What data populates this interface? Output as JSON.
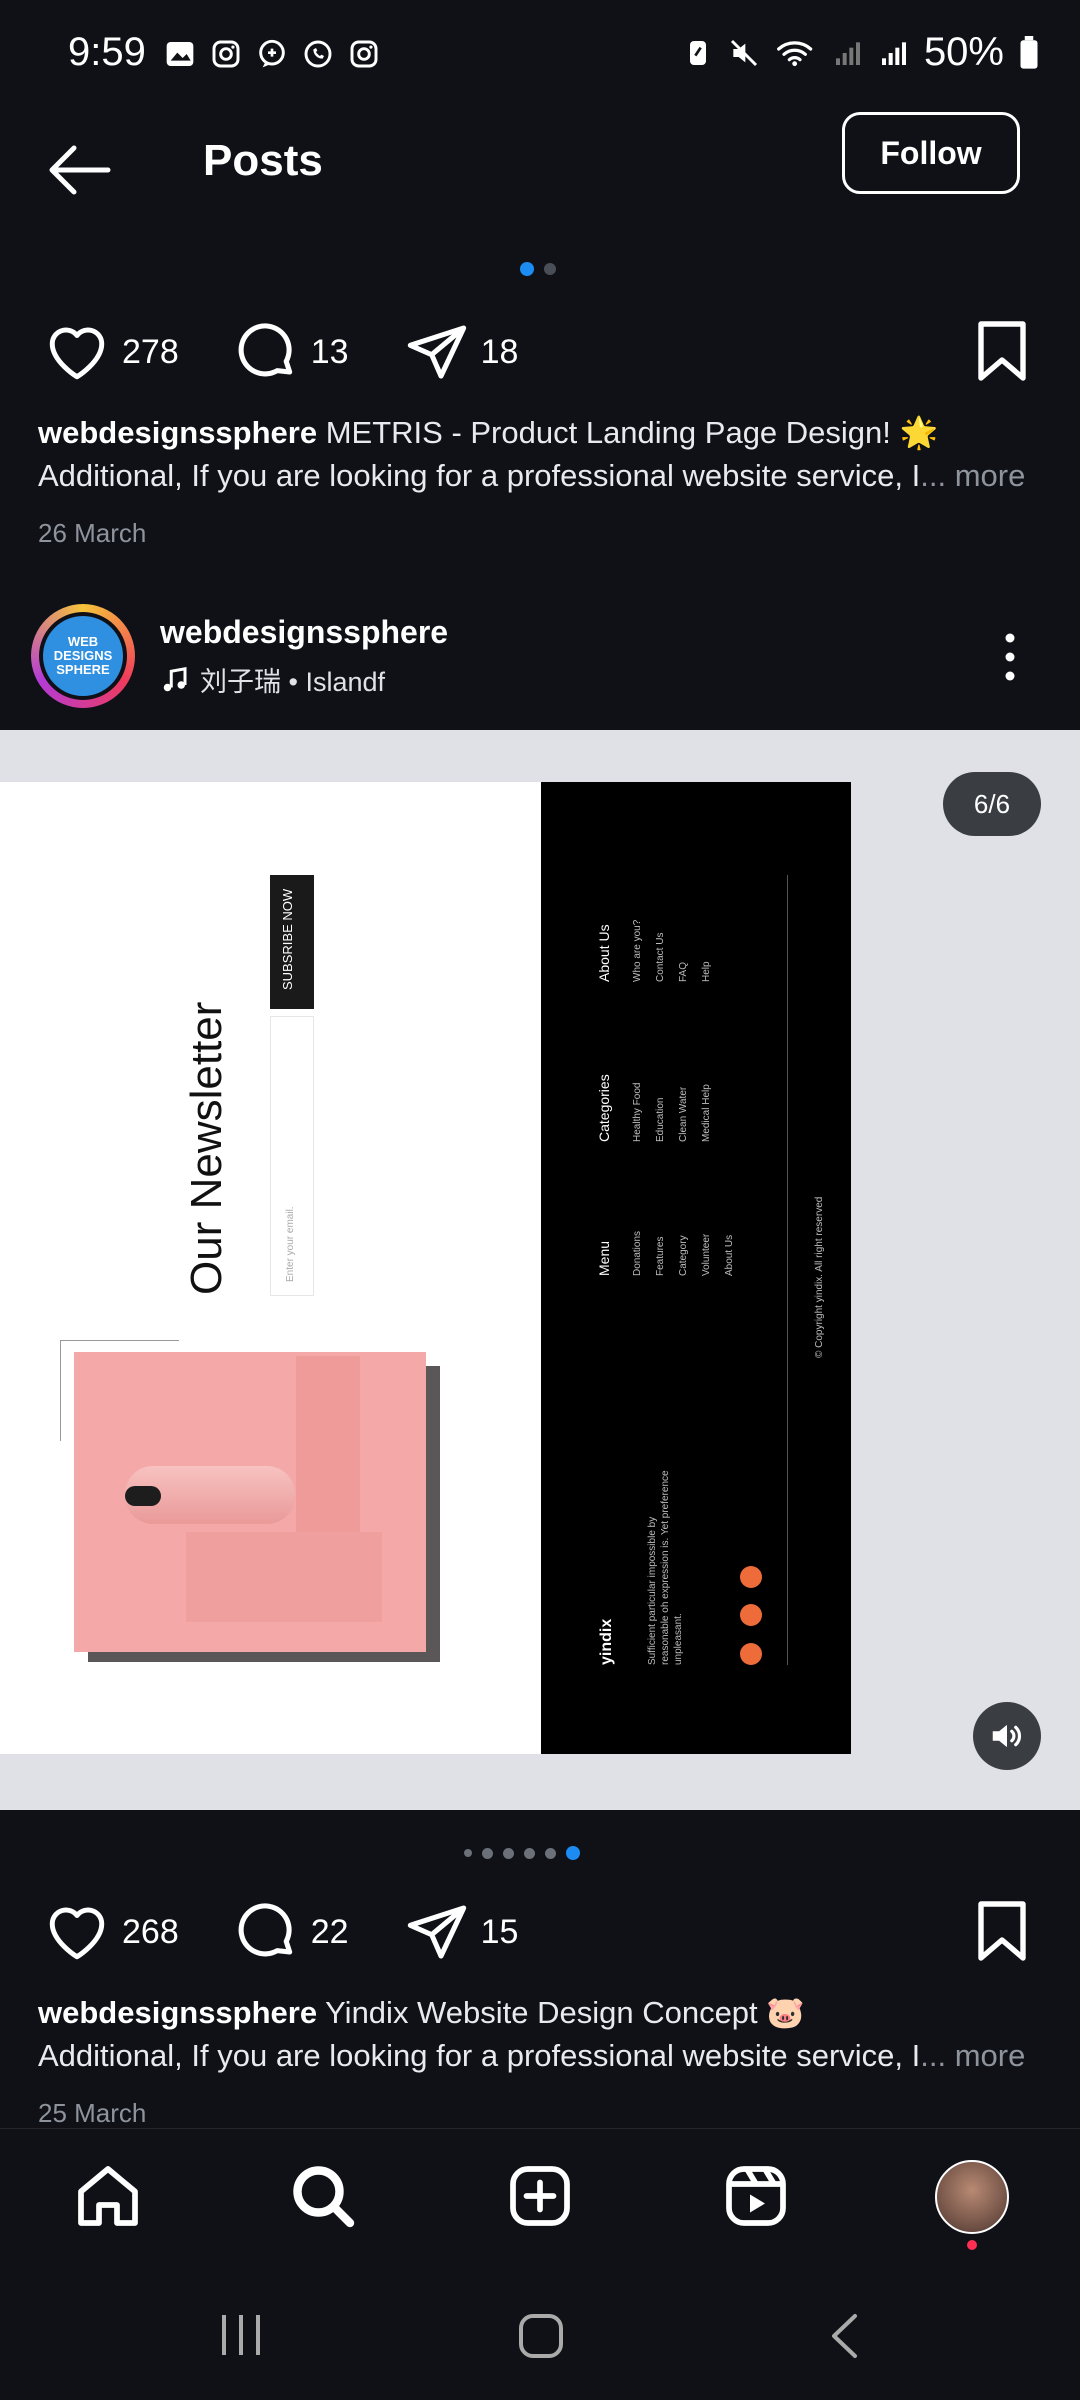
{
  "status_bar": {
    "time": "9:59",
    "battery": "50%"
  },
  "header": {
    "title": "Posts",
    "follow_label": "Follow"
  },
  "post1": {
    "likes": "278",
    "comments": "13",
    "shares": "18",
    "username": "webdesignssphere",
    "caption": "METRIS - Product Landing Page Design! 🌟",
    "caption2": "Additional, If you are looking for a professional website service, I",
    "more_label": "... more",
    "date": "26 March"
  },
  "post2": {
    "username": "webdesignssphere",
    "music": "刘子瑞 • Islandf",
    "avatar_text": "WEB DESIGNS SPHERE",
    "counter": "6/6",
    "image": {
      "newsletter_title": "Our Newsletter",
      "subscribe_label": "SUBSRIBE NOW",
      "email_placeholder": "Enter your email.",
      "footer": {
        "brand": "yindix",
        "tagline": "Sufficient particular impossible by reasonable oh expression is. Yet preference unpleasant.",
        "menu_title": "Menu",
        "menu_items": [
          "Donations",
          "Features",
          "Category",
          "Volunteer",
          "About Us"
        ],
        "categories_title": "Categories",
        "categories_items": [
          "Healthy Food",
          "Education",
          "Clean Water",
          "Medical Help"
        ],
        "about_title": "About Us",
        "about_items": [
          "Who are you?",
          "Contact Us",
          "FAQ",
          "Help"
        ],
        "copyright": "© Copyright yindix. All right reserved"
      }
    },
    "likes": "268",
    "comments": "22",
    "shares": "15",
    "caption": "Yindix Website Design Concept 🐷",
    "caption2": "Additional, If you are looking for a professional website service, I",
    "more_label": "... more",
    "date": "25 March"
  },
  "colors": {
    "background": "#0f1117",
    "accent": "#1d8cf2",
    "notification": "#ff2f54"
  },
  "icons": {
    "nav": [
      "home-icon",
      "search-icon",
      "create-icon",
      "reels-icon",
      "profile-avatar"
    ],
    "actions": [
      "heart-icon",
      "comment-icon",
      "share-icon",
      "bookmark-icon"
    ]
  }
}
